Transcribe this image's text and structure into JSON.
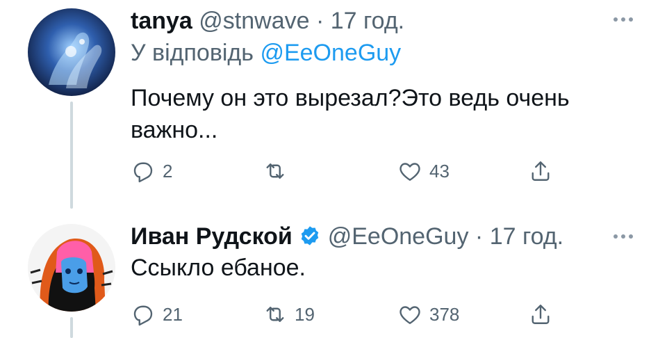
{
  "tweets": [
    {
      "name": "tanya",
      "handle": "@stnwave",
      "separator": "·",
      "time": "17 год.",
      "replying_prefix": "У відповідь",
      "replying_to": "@EeOneGuy",
      "text": "Почему он это вырезал?Это ведь очень важно...",
      "reply_count": "2",
      "retweet_count": "",
      "like_count": "43",
      "avatar_icon": "avatar-icon",
      "colors": {
        "avatar_bg": "#1b2e5c",
        "glow": "#6fa8ff"
      }
    },
    {
      "name": "Иван Рудской",
      "verified": true,
      "handle": "@EeOneGuy",
      "separator": "·",
      "time": "17 год.",
      "text": "Ссыкло ебаное.",
      "reply_count": "21",
      "retweet_count": "19",
      "like_count": "378",
      "avatar_icon": "avatar-icon",
      "colors": {
        "hood": "#e05a1a",
        "hair": "#ff5fa8",
        "face": "#4a9ee8"
      }
    }
  ],
  "icons": {
    "reply": "reply-icon",
    "retweet": "retweet-icon",
    "like": "heart-icon",
    "share": "share-icon",
    "more": "more-icon",
    "verified": "verified-badge-icon"
  },
  "colors": {
    "text": "#0f1419",
    "secondary": "#536471",
    "accent": "#1d9bf0",
    "thread_line": "#cfd9de"
  }
}
